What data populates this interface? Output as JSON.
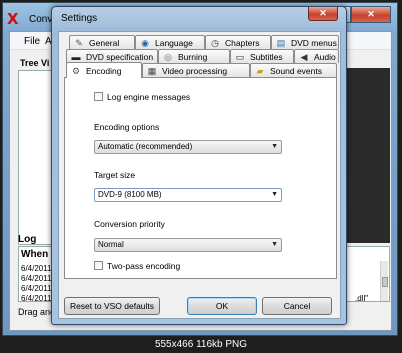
{
  "app": {
    "title": "Conv",
    "menu": [
      "File",
      "Ac"
    ],
    "tree_label": "Tree Vi",
    "log_label": "Log",
    "log_header": "When",
    "log_rows": [
      "6/4/2011",
      "6/4/2011",
      "6/4/2011",
      "6/4/2011"
    ],
    "log_tail": ".dll\"",
    "status_text": "Drag and di",
    "controls": {
      "minimize": "–",
      "maximize": "□",
      "close": "✕"
    }
  },
  "dialog": {
    "title": "Settings",
    "close_glyph": "✕",
    "tabs_row1": [
      {
        "label": "General",
        "icon": "wrench-icon",
        "glyph": "🔧"
      },
      {
        "label": "Language",
        "icon": "globe-icon",
        "glyph": "◉"
      },
      {
        "label": "Chapters",
        "icon": "clock-icon",
        "glyph": "◷"
      },
      {
        "label": "DVD menus",
        "icon": "menu-icon",
        "glyph": "▤"
      }
    ],
    "tabs_row2": [
      {
        "label": "DVD specification",
        "icon": "dvd-icon",
        "glyph": "▬"
      },
      {
        "label": "Burning",
        "icon": "disc-icon",
        "glyph": "◎"
      },
      {
        "label": "Subtitles",
        "icon": "subtitles-icon",
        "glyph": "▭"
      },
      {
        "label": "Audio",
        "icon": "speaker-icon",
        "glyph": "◀"
      }
    ],
    "tabs_row3": [
      {
        "label": "Encoding",
        "icon": "gear-icon",
        "glyph": "⚙"
      },
      {
        "label": "Video processing",
        "icon": "film-icon",
        "glyph": "▦"
      },
      {
        "label": "Sound events",
        "icon": "folder-icon",
        "glyph": "▰"
      }
    ],
    "active_tab": "Encoding",
    "encoding": {
      "log_engine_label": "Log engine messages",
      "log_engine_checked": false,
      "encoding_options_label": "Encoding options",
      "encoding_options_value": "Automatic (recommended)",
      "target_size_label": "Target size",
      "target_size_value": "DVD-9 (8100 MB)",
      "conversion_priority_label": "Conversion priority",
      "conversion_priority_value": "Normal",
      "two_pass_label": "Two-pass encoding",
      "two_pass_checked": false
    },
    "buttons": {
      "reset": "Reset to VSO defaults",
      "ok": "OK",
      "cancel": "Cancel"
    }
  },
  "caption": "555x466 116kb PNG"
}
